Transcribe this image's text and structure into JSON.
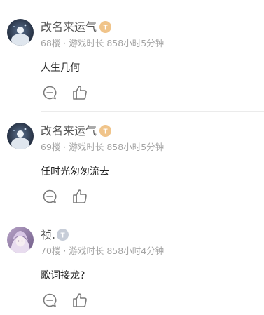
{
  "comments": [
    {
      "username": "改名来运气",
      "badge_color": "#f0c48a",
      "badge_text": "T",
      "floor": "68楼",
      "separator": "·",
      "playtime_label": "游戏时长",
      "playtime": "858小时5分钟",
      "text": "人生几何",
      "reply_icon": "comment-bubble-icon",
      "like_icon": "thumbs-up-icon"
    },
    {
      "username": "改名来运气",
      "badge_color": "#f0c48a",
      "badge_text": "T",
      "floor": "69楼",
      "separator": "·",
      "playtime_label": "游戏时长",
      "playtime": "858小时5分钟",
      "text": "任时光匆匆流去",
      "reply_icon": "comment-bubble-icon",
      "like_icon": "thumbs-up-icon"
    },
    {
      "username": "祯.",
      "badge_color": "#c7cdd8",
      "badge_text": "T",
      "floor": "70楼",
      "separator": "·",
      "playtime_label": "游戏时长",
      "playtime": "858小时4分钟",
      "text": "歌词接龙?",
      "reply_icon": "comment-bubble-icon",
      "like_icon": "thumbs-up-icon"
    }
  ]
}
